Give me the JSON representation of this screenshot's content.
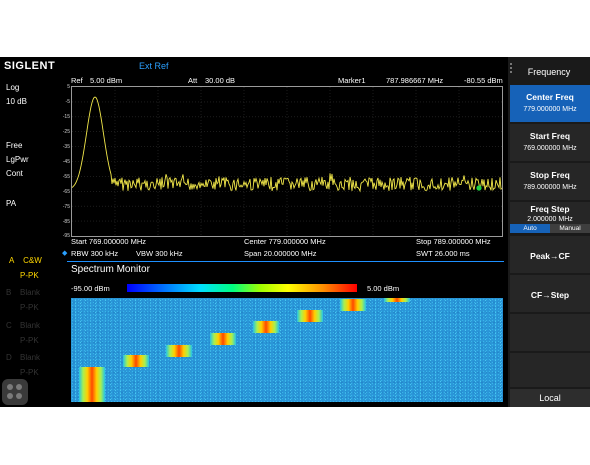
{
  "topbar": {
    "brand": "SIGLENT",
    "ref_source": "Ext Ref"
  },
  "left_panel": {
    "scale_mode": "Log",
    "scale_div": "10 dB",
    "sweep_mode": "Free",
    "detector": "LgPwr",
    "trigger": "Cont",
    "preamp": "PA",
    "trace_letter": "A",
    "trace_mode": "C&W",
    "trace_detector": "P-PK",
    "inactive_traces": [
      "B",
      "Blank",
      "P-PK",
      "C",
      "Blank",
      "P-PK",
      "D",
      "Blank",
      "P-PK"
    ]
  },
  "header": {
    "ref_label": "Ref",
    "ref_value": "5.00 dBm",
    "att_label": "Att",
    "att_value": "30.00 dB",
    "marker_label": "Marker1",
    "marker_freq": "787.986667 MHz",
    "marker_level": "-80.55 dBm"
  },
  "graph": {
    "y_ticks": [
      "5",
      "-5",
      "-15",
      "-25",
      "-35",
      "-45",
      "-55",
      "-65",
      "-75",
      "-85",
      "-95"
    ],
    "trace_color": "#f2e84a",
    "marker_color": "#1fd145"
  },
  "info": {
    "start": "Start  769.000000 MHz",
    "center": "Center  779.000000 MHz",
    "stop": "Stop  789.000000 MHz",
    "rbw": "RBW 300 kHz",
    "vbw": "VBW  300 kHz",
    "span": "Span    20.000000 MHz",
    "swt": "SWT  26.000 ms"
  },
  "spectrum_monitor": {
    "title": "Spectrum Monitor",
    "scale_min": "-95.00 dBm",
    "scale_max": "5.00 dBm"
  },
  "menu": {
    "title": "Frequency",
    "center_freq": {
      "label": "Center Freq",
      "value": "779.000000 MHz"
    },
    "start_freq": {
      "label": "Start Freq",
      "value": "769.000000 MHz"
    },
    "stop_freq": {
      "label": "Stop Freq",
      "value": "789.000000 MHz"
    },
    "freq_step": {
      "label": "Freq Step",
      "value": "2.000000 MHz",
      "options": [
        "Auto",
        "Manual"
      ],
      "selected": "Auto"
    },
    "peak_cf": "Peak→CF",
    "cf_step": "CF→Step",
    "local": "Local"
  },
  "colors": {
    "accent": "#1662b8",
    "brand_blue": "#2aa0ff",
    "trace_yellow": "#ffd800"
  }
}
